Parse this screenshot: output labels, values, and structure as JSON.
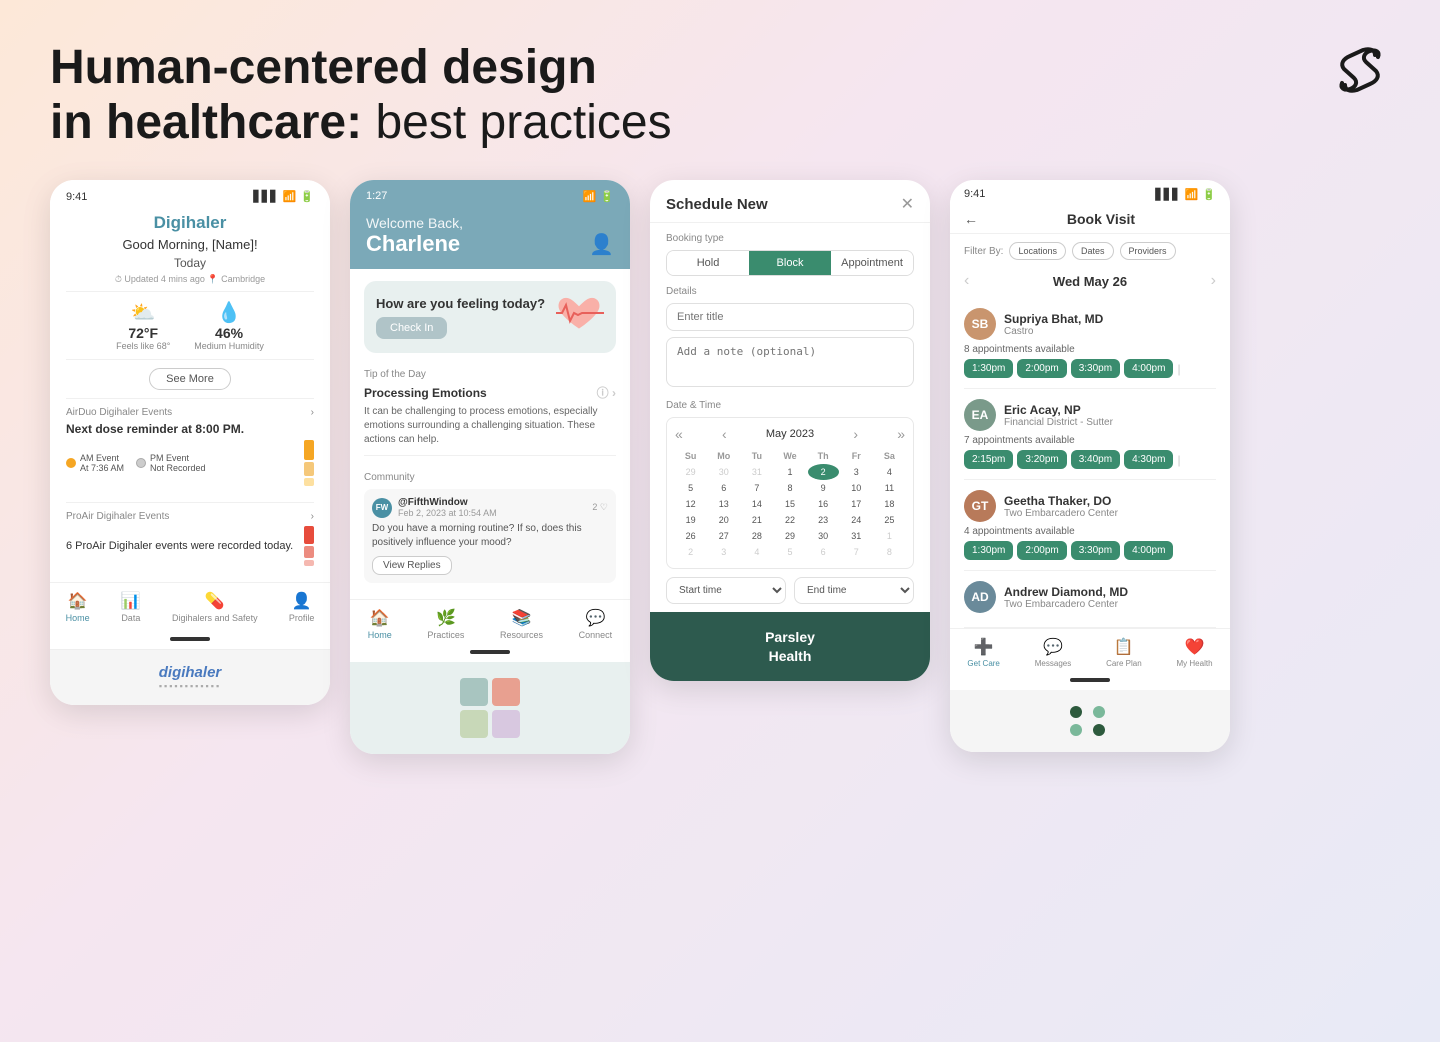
{
  "page": {
    "title_bold": "Human-centered design",
    "title_light_prefix": "in healthcare:",
    "title_light_suffix": " best practices"
  },
  "logo": {
    "alt": "S logo"
  },
  "card1": {
    "status_time": "9:41",
    "app_title": "Digihaler",
    "greeting": "Good Morning, [Name]!",
    "today_label": "Today",
    "updated_text": "⏱ Updated 4 mins ago  📍 Cambridge",
    "temperature": "72°F",
    "feels_like": "Feels like 68°",
    "humidity": "46%",
    "humidity_label": "Medium Humidity",
    "see_more": "See More",
    "airduo_section": "AirDuo Digihaler Events",
    "next_dose": "Next dose reminder at 8:00 PM.",
    "am_event": "AM Event",
    "am_time": "At 7:36 AM",
    "pm_event": "PM Event",
    "pm_recorded": "Not Recorded",
    "proair_section": "ProAir Digihaler Events",
    "proair_events_text": "6 ProAir Digihaler events were recorded today.",
    "nav": [
      "Home",
      "Data",
      "Digihalers and Safety",
      "Profile"
    ],
    "brand_text": "digihaler"
  },
  "card2": {
    "status_time": "1:27",
    "welcome_back": "Welcome Back,",
    "name": "Charlene",
    "feeling_q": "How are you feeling today?",
    "check_in": "Check In",
    "tip_header": "Tip of the Day",
    "tip_title": "Processing Emotions",
    "tip_desc": "It can be challenging to process emotions, especially emotions surrounding a challenging situation. These actions can help.",
    "community_header": "Community",
    "post_author": "@FifthWindow",
    "post_date": "Feb 2, 2023 at 10:54 AM",
    "post_likes": "2 ♡",
    "post_text": "Do you have a morning routine? If so, does this positively influence your mood?",
    "view_replies": "View Replies",
    "nav": [
      "Home",
      "Practices",
      "Resources",
      "Connect"
    ],
    "colors": [
      "#a8c5c0",
      "#e8a090",
      "#c8d8b8",
      "#d8c8e0"
    ]
  },
  "card3": {
    "header": "Schedule New",
    "booking_label": "Booking type",
    "tab_hold": "Hold",
    "tab_block": "Block",
    "tab_appointment": "Appointment",
    "details_label": "Details",
    "title_placeholder": "Enter title",
    "note_placeholder": "Add a note (optional)",
    "datetime_label": "Date & Time",
    "cal_month": "May 2023",
    "cal_days_header": [
      "Su",
      "Mo",
      "Tu",
      "We",
      "Th",
      "Fr",
      "Sa"
    ],
    "cal_rows": [
      [
        "29",
        "30",
        "31",
        "1",
        "2",
        "3",
        "4"
      ],
      [
        "5",
        "6",
        "7",
        "8",
        "9",
        "10",
        "11"
      ],
      [
        "12",
        "13",
        "14",
        "15",
        "16",
        "17",
        "18"
      ],
      [
        "19",
        "20",
        "21",
        "22",
        "23",
        "24",
        "25"
      ],
      [
        "26",
        "27",
        "28",
        "29",
        "30",
        "31",
        "1"
      ],
      [
        "2",
        "3",
        "4",
        "5",
        "6",
        "7",
        "8"
      ]
    ],
    "cal_selected_day": "2",
    "start_time": "Start time",
    "end_time": "End time",
    "brand_line1": "Parsley",
    "brand_line2": "Health"
  },
  "card4": {
    "status_time": "9:41",
    "header": "Book Visit",
    "back_label": "←",
    "filter_by": "Filter By:",
    "filters": [
      "Locations",
      "Dates",
      "Providers"
    ],
    "date_label": "Wed May 26",
    "providers": [
      {
        "name": "Supriya Bhat, MD",
        "location": "Castro",
        "appts": "8 appointments available",
        "slots": [
          "1:30pm",
          "2:00pm",
          "3:30pm",
          "4:00pm"
        ]
      },
      {
        "name": "Eric Acay, NP",
        "location": "Financial District - Sutter",
        "appts": "7 appointments available",
        "slots": [
          "2:15pm",
          "3:20pm",
          "3:40pm",
          "4:30pm"
        ]
      },
      {
        "name": "Geetha Thaker, DO",
        "location": "Two Embarcadero Center",
        "appts": "4 appointments available",
        "slots": [
          "1:30pm",
          "2:00pm",
          "3:30pm",
          "4:00pm"
        ]
      },
      {
        "name": "Andrew Diamond, MD",
        "location": "Two Embarcadero Center",
        "appts": "",
        "slots": []
      }
    ],
    "nav": [
      "Get Care",
      "Messages",
      "Care Plan",
      "My Health"
    ],
    "nav_icons": [
      "➕",
      "💬",
      "📋",
      "❤️"
    ]
  }
}
